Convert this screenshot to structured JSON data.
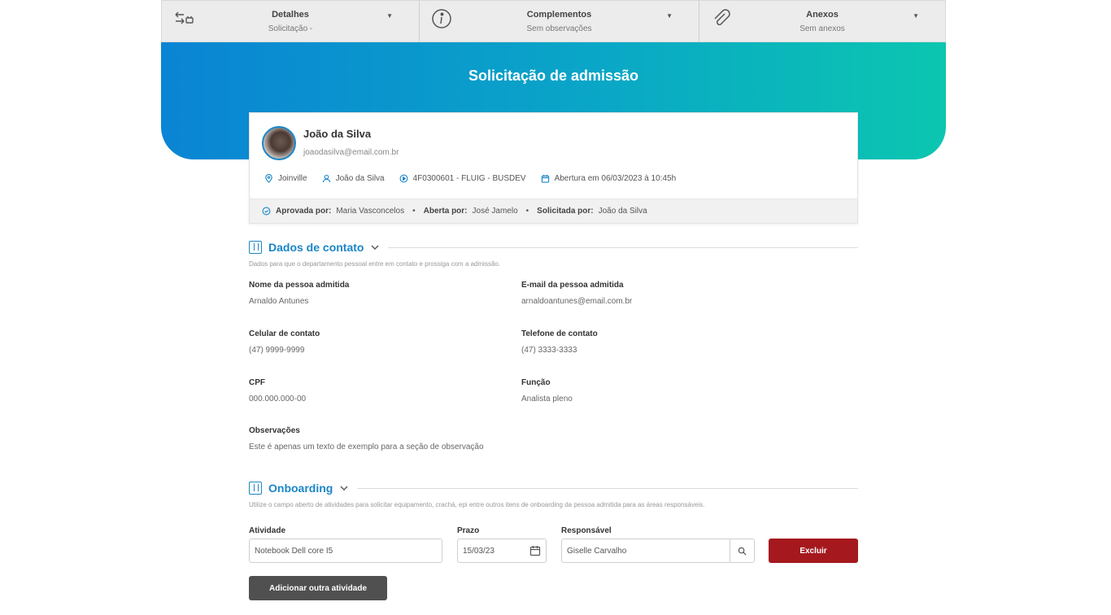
{
  "topbar": {
    "tabs": [
      {
        "icon": "transfer-icon",
        "title": "Detalhes",
        "subtitle": "Solicitação -"
      },
      {
        "icon": "info-icon",
        "title": "Complementos",
        "subtitle": "Sem observações"
      },
      {
        "icon": "paperclip-icon",
        "title": "Anexos",
        "subtitle": "Sem anexos"
      }
    ]
  },
  "hero": {
    "title": "Solicitação de admissão"
  },
  "requester": {
    "name": "João da Silva",
    "email": "joaodasilva@email.com.br",
    "city": "Joinville",
    "user": "João da Silva",
    "code": "4F0300601 - FLUIG - BUSDEV",
    "opened": "Abertura em 06/03/2023 à 10:45h",
    "approved_label": "Aprovada por:",
    "approved_value": "Maria Vasconcelos",
    "opened_by_label": "Aberta por:",
    "opened_by_value": "José Jamelo",
    "requested_by_label": "Solicitada por:",
    "requested_by_value": "João da Silva",
    "bullet": "•"
  },
  "contact": {
    "title": "Dados de contato",
    "description": "Dados para que o departamento pessoal entre em contato e prossiga com a admissão.",
    "fields": [
      {
        "label": "Nome da pessoa admitida",
        "value": "Arnaldo Antunes"
      },
      {
        "label": "E-mail da pessoa admitida",
        "value": "arnaldoantunes@email.com.br"
      },
      {
        "label": "Celular de contato",
        "value": "(47) 9999-9999"
      },
      {
        "label": "Telefone de contato",
        "value": "(47) 3333-3333"
      },
      {
        "label": "CPF",
        "value": "000.000.000-00"
      },
      {
        "label": "Função",
        "value": "Analista pleno"
      },
      {
        "label": "Observações",
        "value": "Este é apenas um texto de exemplo para a seção de observação"
      }
    ]
  },
  "onboarding": {
    "title": "Onboarding",
    "description": "Utilize o campo aberto de atividades para solicitar equipamento, crachá, epi entre outros itens de onboarding da pessoa admitida para as áreas responsáveis.",
    "activity_label": "Atividade",
    "activity_value": "Notebook Dell core I5",
    "deadline_label": "Prazo",
    "deadline_value": "15/03/23",
    "owner_label": "Responsável",
    "owner_value": "Giselle Carvalho",
    "delete_button": "Excluir",
    "add_button": "Adicionar outra atividade"
  },
  "colors": {
    "accent": "#1a86c8",
    "danger": "#a5191e",
    "dark_button": "#505050",
    "hero_start": "#0a84d4",
    "hero_end": "#0bc6b0"
  }
}
